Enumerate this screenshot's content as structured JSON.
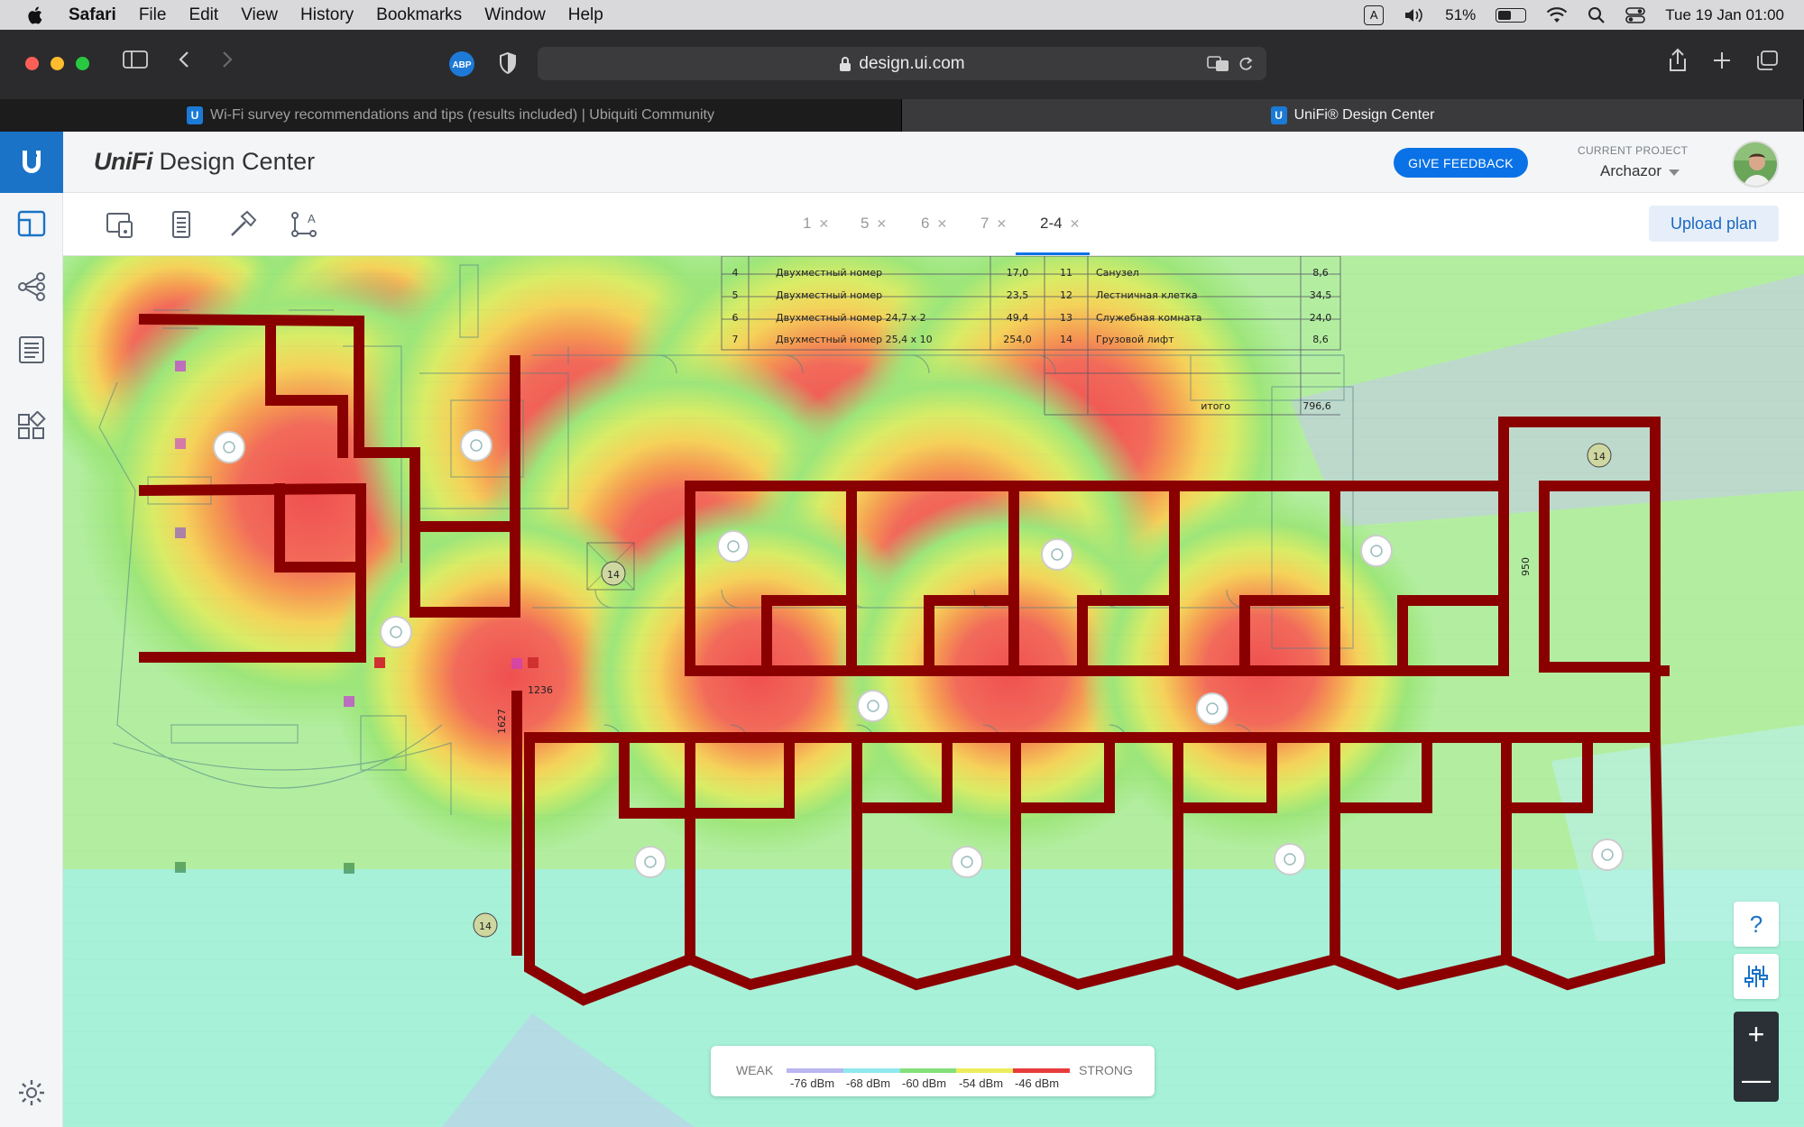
{
  "menubar": {
    "app": "Safari",
    "items": [
      "File",
      "Edit",
      "View",
      "History",
      "Bookmarks",
      "Window",
      "Help"
    ],
    "input_indicator": "A",
    "battery": "51%",
    "battery_level": 0.51,
    "datetime": "Tue 19 Jan  01:00"
  },
  "browser": {
    "url": "design.ui.com",
    "abp_badge": "ABP",
    "tabs": [
      {
        "title": "Wi-Fi survey recommendations and tips (results included) | Ubiquiti Community",
        "active": false
      },
      {
        "title": "UniFi® Design Center",
        "active": true
      }
    ]
  },
  "app": {
    "brand_italic": "UniFi",
    "brand_rest": " Design Center",
    "feedback_label": "GIVE FEEDBACK",
    "project_label": "CURRENT PROJECT",
    "project_name": "Archazor"
  },
  "toolbar": {
    "floors": [
      {
        "label": "1",
        "active": false
      },
      {
        "label": "5",
        "active": false
      },
      {
        "label": "6",
        "active": false
      },
      {
        "label": "7",
        "active": false
      },
      {
        "label": "2-4",
        "active": true
      }
    ],
    "upload_label": "Upload plan"
  },
  "controls": {
    "help": "?",
    "zoom_in": "+",
    "zoom_out": "—"
  },
  "legend": {
    "weak": "WEAK",
    "strong": "STRONG",
    "levels": [
      "-76 dBm",
      "-68 dBm",
      "-60 dBm",
      "-54 dBm",
      "-46 dBm"
    ],
    "colors": [
      "#b9b6f0",
      "#8ee9ee",
      "#84e07a",
      "#ecec5c",
      "#e83c3c"
    ]
  },
  "floorplan": {
    "table_rows": [
      [
        "4",
        "Двухместный номер",
        "17,0",
        "11",
        "Санузел",
        "8,6"
      ],
      [
        "5",
        "Двухместный номер",
        "23,5",
        "12",
        "Лестничная клетка",
        "34,5"
      ],
      [
        "6",
        "Двухместный номер   24,7 x 2",
        "49,4",
        "13",
        "Служебная комната",
        "24,0"
      ],
      [
        "7",
        "Двухместный номер   25,4 x 10",
        "254,0",
        "14",
        "Грузовой лифт",
        "8,6"
      ]
    ],
    "total_label": "итого",
    "total_value": "796,6",
    "room_markers": [
      "14",
      "14",
      "14"
    ],
    "dimension_labels": [
      "1236",
      "1627",
      "950"
    ]
  }
}
